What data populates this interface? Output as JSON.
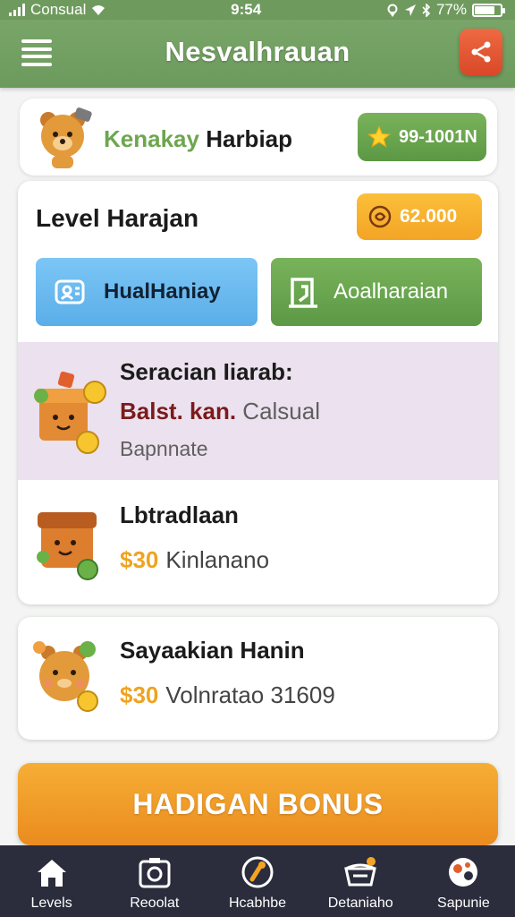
{
  "status_bar": {
    "carrier": "Consual",
    "time": "9:54",
    "battery": "77%",
    "battery_level": 0.77
  },
  "header": {
    "title": "Nesvalhrauan"
  },
  "profile": {
    "first_name": "Kenakay",
    "last_name": "Harbiap",
    "stars": "99-1001N"
  },
  "level": {
    "title": "Level Harajan",
    "coins": "62.000"
  },
  "actions": {
    "primary": "HualHaniay",
    "secondary": "Aoalharaian"
  },
  "items": [
    {
      "title": "Seracian Iiarab:",
      "accent": "Balst. kan.",
      "muted": "Calsual",
      "line3": "Bapnnate"
    },
    {
      "title": "Lbtradlaan",
      "price": "$30",
      "desc": "Kinlanano"
    },
    {
      "title": "Sayaakian Hanin",
      "price": "$30",
      "desc": "Volnratao 31609"
    }
  ],
  "bonus": {
    "label": "HADIGAN BONUS"
  },
  "tabs": [
    {
      "label": "Levels",
      "icon": "home-icon"
    },
    {
      "label": "Reoolat",
      "icon": "camera-icon"
    },
    {
      "label": "Hcabhbe",
      "icon": "badge-icon"
    },
    {
      "label": "Detaniaho",
      "icon": "basket-icon"
    },
    {
      "label": "Sapunie",
      "icon": "ball-icon"
    }
  ],
  "colors": {
    "header": "#6f9a5e",
    "accent_orange": "#f3a425",
    "accent_green": "#5d9946",
    "accent_blue": "#5aaee8",
    "share": "#e0552f",
    "tabbar": "#2b2d3c"
  }
}
